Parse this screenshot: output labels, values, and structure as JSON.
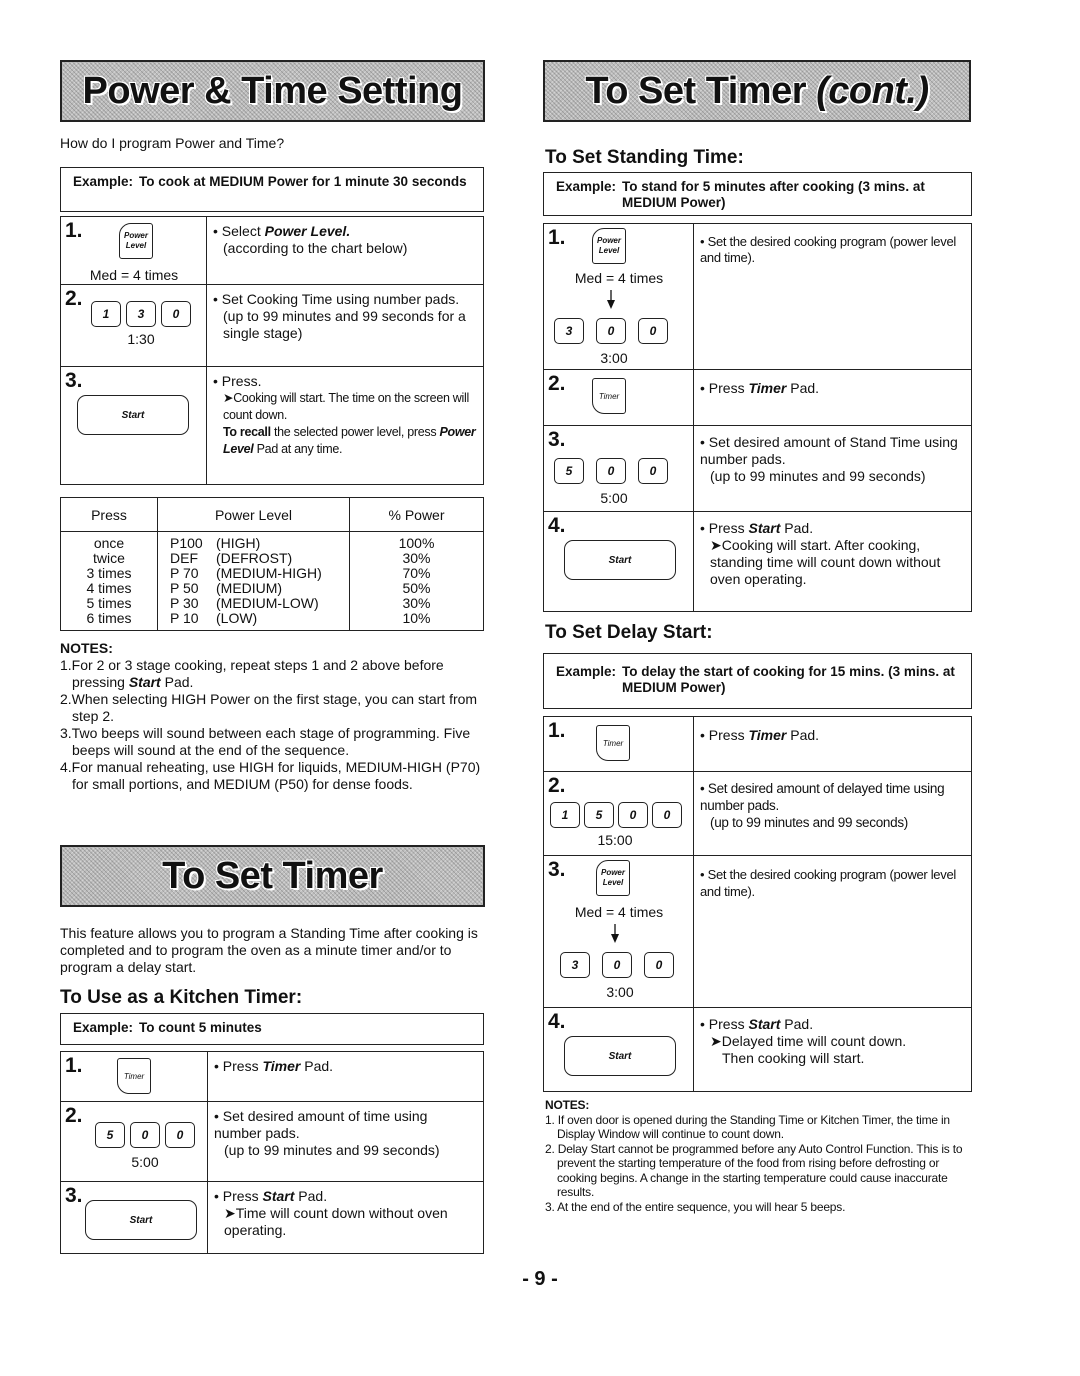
{
  "left": {
    "banner_title": "Power & Time Setting",
    "question": "How do I program Power and Time?",
    "example": {
      "label": "Example:",
      "text": "To cook at MEDIUM Power for 1 minute 30 seconds"
    },
    "steps": [
      {
        "num": "1.",
        "pad": "Power Level",
        "pad_line1": "Power",
        "pad_line2": "Level",
        "caption": "Med = 4 times",
        "text_pre": "Select ",
        "text_em": "Power Level.",
        "text_line2": "(according to the chart below)"
      },
      {
        "num": "2.",
        "keys": [
          "1",
          "3",
          "0"
        ],
        "caption": "1:30",
        "text": "Set Cooking Time using number pads.",
        "text_line2": "(up to 99 minutes and 99 seconds for a single stage)"
      },
      {
        "num": "3.",
        "pad": "Start",
        "text": "Press.",
        "result": "Cooking will start. The time on the screen will count down.",
        "recall_bold": "To recall",
        "recall_text": " the selected power level, press ",
        "recall_em": "Power Level",
        "recall_end": " Pad at any time."
      }
    ],
    "power_table": {
      "headers": [
        "Press",
        "Power Level",
        "% Power"
      ],
      "rows": [
        {
          "press": "once",
          "code": "P100",
          "level": "(HIGH)",
          "percent": "100%"
        },
        {
          "press": "twice",
          "code": "DEF",
          "level": "(DEFROST)",
          "percent": "30%"
        },
        {
          "press": "3 times",
          "code": "P 70",
          "level": "(MEDIUM-HIGH)",
          "percent": "70%"
        },
        {
          "press": "4 times",
          "code": "P 50",
          "level": "(MEDIUM)",
          "percent": "50%"
        },
        {
          "press": "5 times",
          "code": "P 30",
          "level": "(MEDIUM-LOW)",
          "percent": "30%"
        },
        {
          "press": "6 times",
          "code": "P 10",
          "level": "(LOW)",
          "percent": "10%"
        }
      ]
    },
    "notes": {
      "title": "NOTES:",
      "items": [
        {
          "pre": "1.For 2 or 3 stage cooking, repeat steps 1 and 2 above before pressing ",
          "em": "Start",
          "post": " Pad."
        },
        {
          "pre": "2.When selecting HIGH Power on the first stage, you can start from step 2.",
          "em": "",
          "post": ""
        },
        {
          "pre": "3.Two beeps will sound between each stage of programming. Five beeps will sound at the end of the sequence.",
          "em": "",
          "post": ""
        },
        {
          "pre": "4.For manual reheating, use HIGH for liquids, MEDIUM-HIGH (P70) for small portions, and MEDIUM (P50) for dense foods.",
          "em": "",
          "post": ""
        }
      ]
    },
    "timer_banner_title": "To Set Timer",
    "timer_intro": "This feature allows you to program a Standing Time after cooking is completed and to program the oven as a minute timer and/or to program a delay start.",
    "kitchen": {
      "heading": "To Use as a Kitchen Timer:",
      "example": {
        "label": "Example:",
        "text": "To count 5 minutes"
      },
      "steps": [
        {
          "num": "1.",
          "pad": "Timer",
          "text_pre": "Press ",
          "text_em": "Timer",
          "text_post": " Pad."
        },
        {
          "num": "2.",
          "keys": [
            "5",
            "0",
            "0"
          ],
          "caption": "5:00",
          "text": "Set desired amount of time using number pads.",
          "text_line2": "(up to 99 minutes and 99 seconds)"
        },
        {
          "num": "3.",
          "pad": "Start",
          "text_pre": "Press ",
          "text_em": "Start",
          "text_post": " Pad.",
          "result": "Time will count down without oven operating."
        }
      ]
    }
  },
  "right": {
    "banner_title": "To Set Timer",
    "banner_title_em": "(cont.)",
    "standing": {
      "heading": "To Set Standing Time:",
      "example": {
        "label": "Example:",
        "text": "To stand for 5 minutes after cooking (3 mins. at MEDIUM Power)"
      },
      "steps": [
        {
          "num": "1.",
          "pad_line1": "Power",
          "pad_line2": "Level",
          "caption": "Med = 4 times",
          "keys": [
            "3",
            "0",
            "0"
          ],
          "caption2": "3:00",
          "text": "Set the desired cooking program (power level and time)."
        },
        {
          "num": "2.",
          "pad": "Timer",
          "text_pre": "Press ",
          "text_em": "Timer",
          "text_post": " Pad."
        },
        {
          "num": "3.",
          "keys": [
            "5",
            "0",
            "0"
          ],
          "caption": "5:00",
          "text": "Set desired amount of Stand Time using number pads.",
          "text_line2": "(up to 99 minutes and 99 seconds)"
        },
        {
          "num": "4.",
          "pad": "Start",
          "text_pre": "Press ",
          "text_em": "Start",
          "text_post": " Pad.",
          "result": "Cooking will start. After cooking, standing time will count down without oven operating."
        }
      ]
    },
    "delay": {
      "heading": "To Set Delay Start:",
      "example": {
        "label": "Example:",
        "text": "To delay the start of cooking for 15 mins. (3 mins. at MEDIUM Power)"
      },
      "steps": [
        {
          "num": "1.",
          "pad": "Timer",
          "text_pre": "Press ",
          "text_em": "Timer",
          "text_post": " Pad."
        },
        {
          "num": "2.",
          "keys": [
            "1",
            "5",
            "0",
            "0"
          ],
          "caption": "15:00",
          "text": "Set desired amount of delayed time using number pads.",
          "text_line2": "(up to 99 minutes and 99 seconds)"
        },
        {
          "num": "3.",
          "pad_line1": "Power",
          "pad_line2": "Level",
          "caption": "Med = 4 times",
          "keys": [
            "3",
            "0",
            "0"
          ],
          "caption2": "3:00",
          "text": "Set the desired cooking program (power level and time)."
        },
        {
          "num": "4.",
          "pad": "Start",
          "text_pre": "Press ",
          "text_em": "Start",
          "text_post": " Pad.",
          "result": "Delayed time will count down.",
          "result2": "Then cooking will start."
        }
      ]
    },
    "notes": {
      "title": "NOTES:",
      "items": [
        "1. If oven door is opened during the Standing Time or Kitchen Timer, the time in Display Window will continue to count down.",
        "2. Delay Start cannot be programmed before any Auto Control Function. This is to prevent the starting temperature of the food from rising before defrosting or cooking begins. A change in the starting temperature could cause inaccurate results.",
        "3. At the end of the entire sequence, you will hear 5 beeps."
      ]
    }
  },
  "page_number": "- 9 -",
  "arrow_glyph": "➤"
}
